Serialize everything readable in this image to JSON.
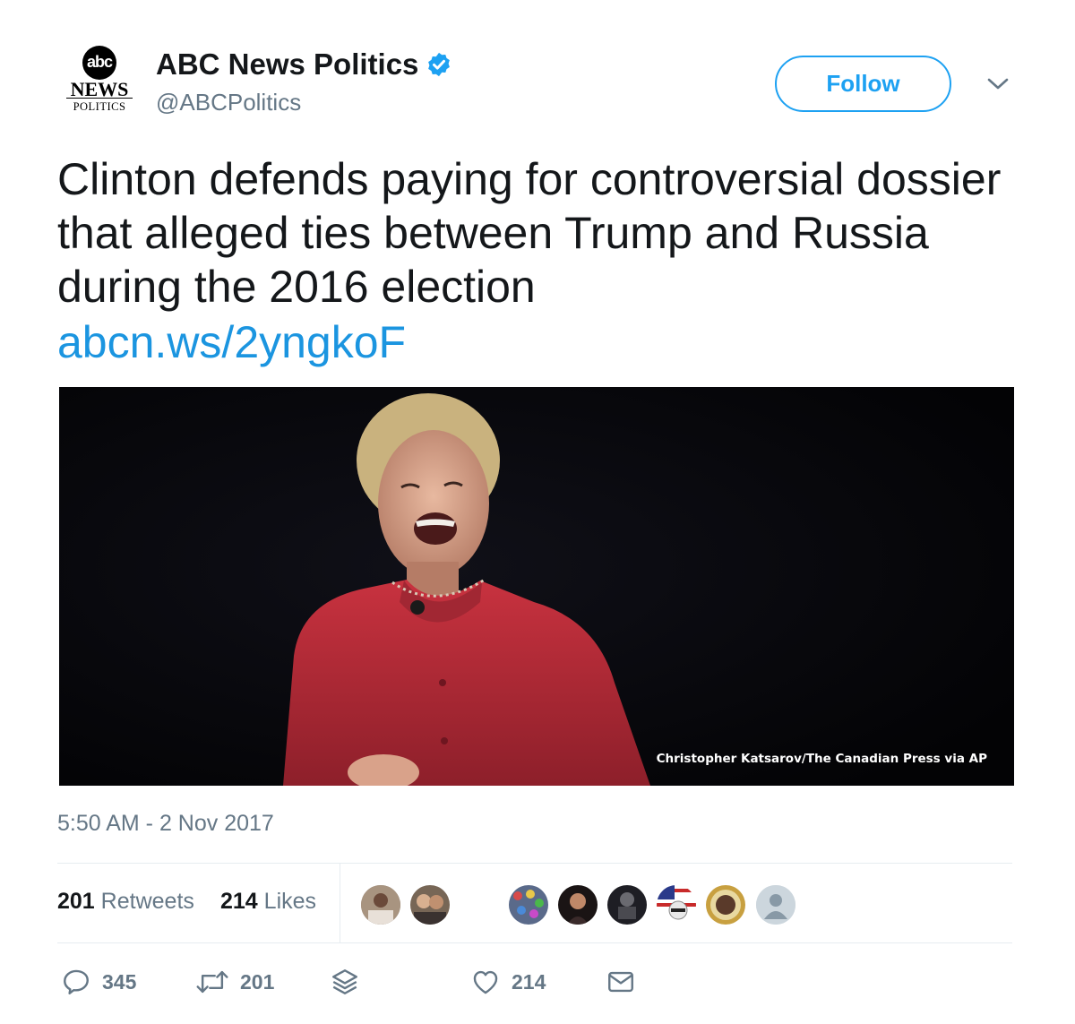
{
  "account": {
    "logo_abc": "abc",
    "logo_news": "NEWS",
    "logo_politics": "POLITICS",
    "display_name": "ABC News Politics",
    "handle": "@ABCPolitics",
    "verified": true
  },
  "follow_label": "Follow",
  "tweet": {
    "text": "Clinton defends paying for controversial dossier that alleged ties between Trump and Russia during the 2016 election",
    "link": "abcn.ws/2yngkoF",
    "photo_credit": "Christopher Katsarov/The Canadian Press via AP",
    "timestamp": "5:50 AM - 2 Nov 2017"
  },
  "stats": {
    "retweets_count": "201",
    "retweets_label": "Retweets",
    "likes_count": "214",
    "likes_label": "Likes"
  },
  "actions": {
    "reply_count": "345",
    "retweet_count": "201",
    "like_count": "214"
  },
  "icons": [
    "verified-icon",
    "chevron-down-icon",
    "reply-icon",
    "retweet-icon",
    "stack-icon",
    "heart-icon",
    "envelope-icon",
    "default-avatar-icon"
  ],
  "colors": {
    "accent": "#1da1f2",
    "link": "#1b95e0",
    "muted": "#657786",
    "text": "#14171a"
  }
}
